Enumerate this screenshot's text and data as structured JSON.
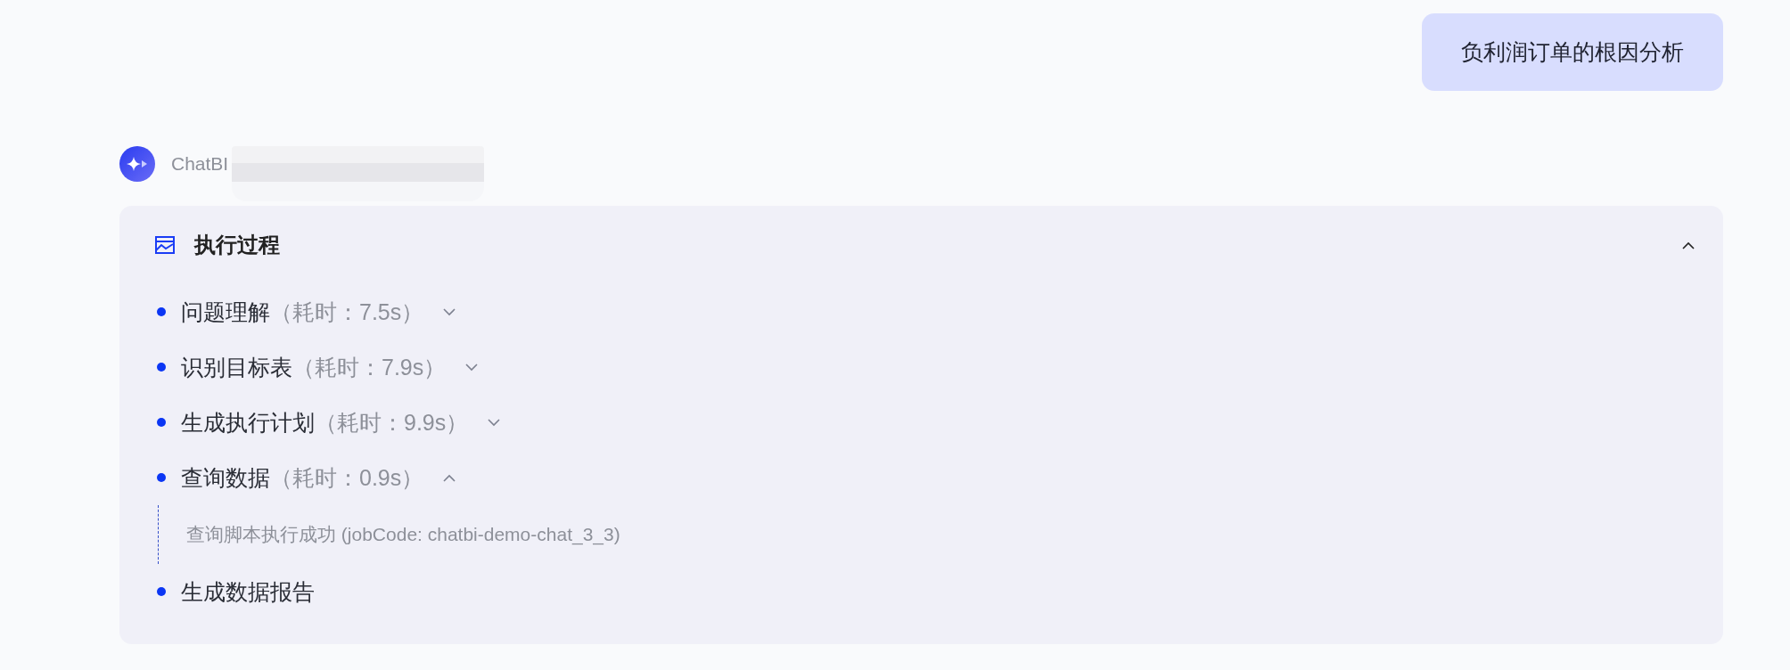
{
  "user_message": {
    "text": "负利润订单的根因分析"
  },
  "assistant": {
    "name": "ChatBI",
    "redacted": true
  },
  "process_panel": {
    "title": "执行过程",
    "expanded": true,
    "steps": [
      {
        "kind": "collapsible",
        "label": "问题理解",
        "duration": "（耗时：7.5s）",
        "expanded": false
      },
      {
        "kind": "collapsible",
        "label": "识别目标表",
        "duration": "（耗时：7.9s）",
        "expanded": false
      },
      {
        "kind": "collapsible",
        "label": "生成执行计划",
        "duration": "（耗时：9.9s）",
        "expanded": false
      },
      {
        "kind": "collapsible",
        "label": "查询数据",
        "duration": "（耗时：0.9s）",
        "expanded": true,
        "detail": "查询脚本执行成功 (jobCode: chatbi-demo-chat_3_3)"
      },
      {
        "kind": "plain",
        "label": "生成数据报告"
      }
    ]
  }
}
